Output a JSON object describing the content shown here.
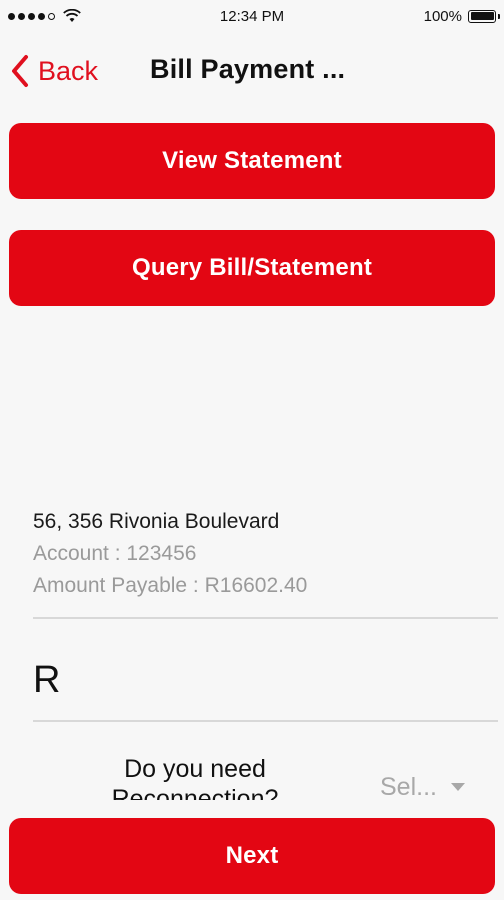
{
  "status_bar": {
    "time": "12:34 PM",
    "battery": "100%"
  },
  "nav": {
    "back_label": "Back",
    "title": "Bill Payment ..."
  },
  "actions": {
    "view_statement": "View Statement",
    "query_bill": "Query Bill/Statement"
  },
  "account": {
    "address": "56, 356 Rivonia Boulevard",
    "account_line": "Account : 123456",
    "amount_line": "Amount Payable : R16602.40"
  },
  "amount_input": {
    "value": "R"
  },
  "reconnection": {
    "question": "Do you need Reconnection?",
    "select_value": "Sel..."
  },
  "footer": {
    "next_label": "Next"
  },
  "colors": {
    "accent": "#e30613",
    "back": "#e0101f",
    "muted": "#9a9a9a"
  }
}
